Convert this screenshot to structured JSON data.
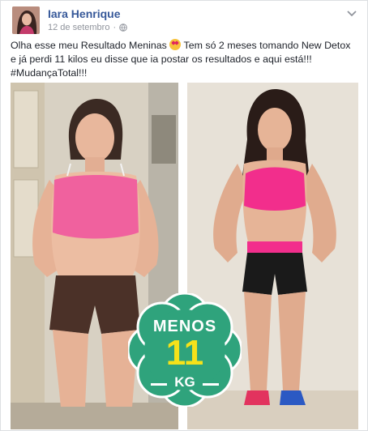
{
  "post": {
    "author": "Iara Henrique",
    "date": "12 de setembro",
    "privacy_icon": "globe-icon",
    "menu_icon": "chevron-down-icon",
    "text_line1_a": "Olha esse meu Resultado Meninas",
    "text_line1_emoji": "heart-eyes-emoji",
    "text_line1_b": "Tem só 2 meses tomando  New Detox",
    "text_line2": "e já perdi 11 kilos eu disse que ia postar os resultados e aqui está!!!",
    "text_line3": "#MudançaTotal!!!"
  },
  "badge": {
    "top": "MENOS",
    "number": "11",
    "unit": "KG",
    "colors": {
      "fill": "#2fa37c",
      "number": "#f5e21a",
      "text": "#ffffff"
    }
  },
  "colors": {
    "author": "#365899",
    "meta": "#90949c",
    "text": "#1d2129"
  }
}
